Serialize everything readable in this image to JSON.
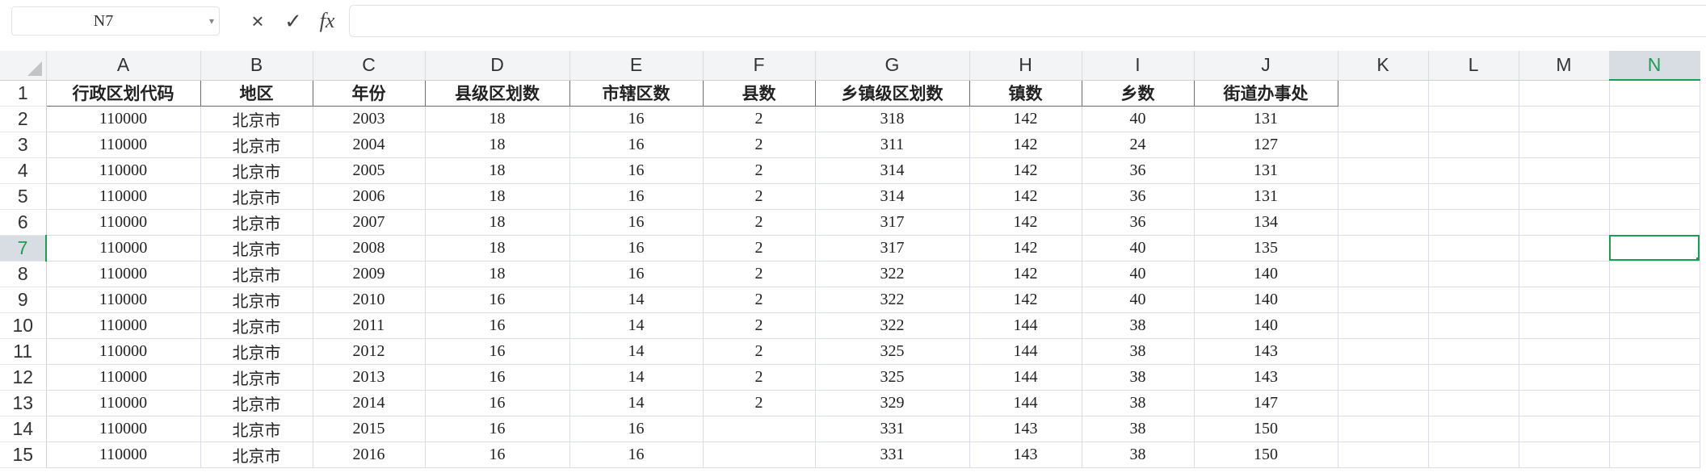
{
  "name_box": {
    "value": "N7"
  },
  "formula_bar": {
    "cancel_icon": "×",
    "confirm_icon": "✓",
    "fx_label": "fx",
    "value": ""
  },
  "columns": [
    "A",
    "B",
    "C",
    "D",
    "E",
    "F",
    "G",
    "H",
    "I",
    "J",
    "K",
    "L",
    "M",
    "N"
  ],
  "active_column": "N",
  "active_row": "7",
  "rows": [
    {
      "num": "1",
      "cells": [
        "行政区划代码",
        "地区",
        "年份",
        "县级区划数",
        "市辖区数",
        "县数",
        "乡镇级区划数",
        "镇数",
        "乡数",
        "街道办事处",
        "",
        "",
        "",
        ""
      ]
    },
    {
      "num": "2",
      "cells": [
        "110000",
        "北京市",
        "2003",
        "18",
        "16",
        "2",
        "318",
        "142",
        "40",
        "131",
        "",
        "",
        "",
        ""
      ]
    },
    {
      "num": "3",
      "cells": [
        "110000",
        "北京市",
        "2004",
        "18",
        "16",
        "2",
        "311",
        "142",
        "24",
        "127",
        "",
        "",
        "",
        ""
      ]
    },
    {
      "num": "4",
      "cells": [
        "110000",
        "北京市",
        "2005",
        "18",
        "16",
        "2",
        "314",
        "142",
        "36",
        "131",
        "",
        "",
        "",
        ""
      ]
    },
    {
      "num": "5",
      "cells": [
        "110000",
        "北京市",
        "2006",
        "18",
        "16",
        "2",
        "314",
        "142",
        "36",
        "131",
        "",
        "",
        "",
        ""
      ]
    },
    {
      "num": "6",
      "cells": [
        "110000",
        "北京市",
        "2007",
        "18",
        "16",
        "2",
        "317",
        "142",
        "36",
        "134",
        "",
        "",
        "",
        ""
      ]
    },
    {
      "num": "7",
      "cells": [
        "110000",
        "北京市",
        "2008",
        "18",
        "16",
        "2",
        "317",
        "142",
        "40",
        "135",
        "",
        "",
        "",
        ""
      ]
    },
    {
      "num": "8",
      "cells": [
        "110000",
        "北京市",
        "2009",
        "18",
        "16",
        "2",
        "322",
        "142",
        "40",
        "140",
        "",
        "",
        "",
        ""
      ]
    },
    {
      "num": "9",
      "cells": [
        "110000",
        "北京市",
        "2010",
        "16",
        "14",
        "2",
        "322",
        "142",
        "40",
        "140",
        "",
        "",
        "",
        ""
      ]
    },
    {
      "num": "10",
      "cells": [
        "110000",
        "北京市",
        "2011",
        "16",
        "14",
        "2",
        "322",
        "144",
        "38",
        "140",
        "",
        "",
        "",
        ""
      ]
    },
    {
      "num": "11",
      "cells": [
        "110000",
        "北京市",
        "2012",
        "16",
        "14",
        "2",
        "325",
        "144",
        "38",
        "143",
        "",
        "",
        "",
        ""
      ]
    },
    {
      "num": "12",
      "cells": [
        "110000",
        "北京市",
        "2013",
        "16",
        "14",
        "2",
        "325",
        "144",
        "38",
        "143",
        "",
        "",
        "",
        ""
      ]
    },
    {
      "num": "13",
      "cells": [
        "110000",
        "北京市",
        "2014",
        "16",
        "14",
        "2",
        "329",
        "144",
        "38",
        "147",
        "",
        "",
        "",
        ""
      ]
    },
    {
      "num": "14",
      "cells": [
        "110000",
        "北京市",
        "2015",
        "16",
        "16",
        "",
        "331",
        "143",
        "38",
        "150",
        "",
        "",
        "",
        ""
      ]
    },
    {
      "num": "15",
      "cells": [
        "110000",
        "北京市",
        "2016",
        "16",
        "16",
        "",
        "331",
        "143",
        "38",
        "150",
        "",
        "",
        "",
        ""
      ]
    }
  ],
  "colors": {
    "accent": "#1e9c56",
    "header_bg": "#f3f4f6",
    "active_header_bg": "#d8dde3"
  }
}
